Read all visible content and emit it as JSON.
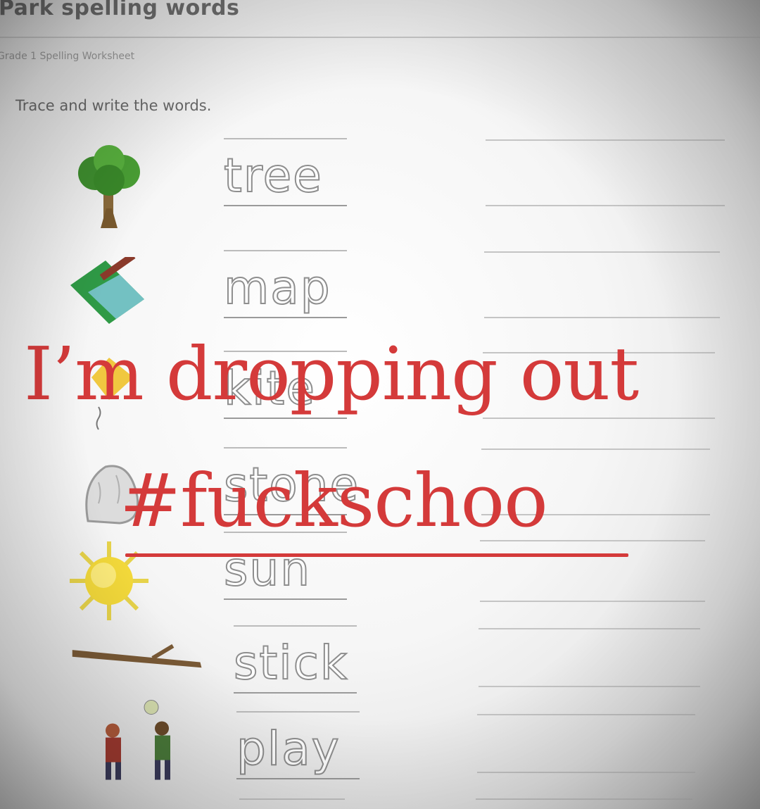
{
  "worksheet": {
    "title": "Park spelling words",
    "subtitle": "Grade 1 Spelling Worksheet",
    "instruction": "Trace and write the words."
  },
  "words": [
    {
      "word": "tree",
      "icon": "tree-icon"
    },
    {
      "word": "map",
      "icon": "map-icon"
    },
    {
      "word": "kite",
      "icon": "kite-icon"
    },
    {
      "word": "stone",
      "icon": "stone-icon"
    },
    {
      "word": "sun",
      "icon": "sun-icon"
    },
    {
      "word": "stick",
      "icon": "stick-icon"
    },
    {
      "word": "play",
      "icon": "kids-playing-icon"
    }
  ],
  "overlay": {
    "line1": "I’m dropping out",
    "line2": "#fuckschoo",
    "color": "#d43a3a"
  }
}
